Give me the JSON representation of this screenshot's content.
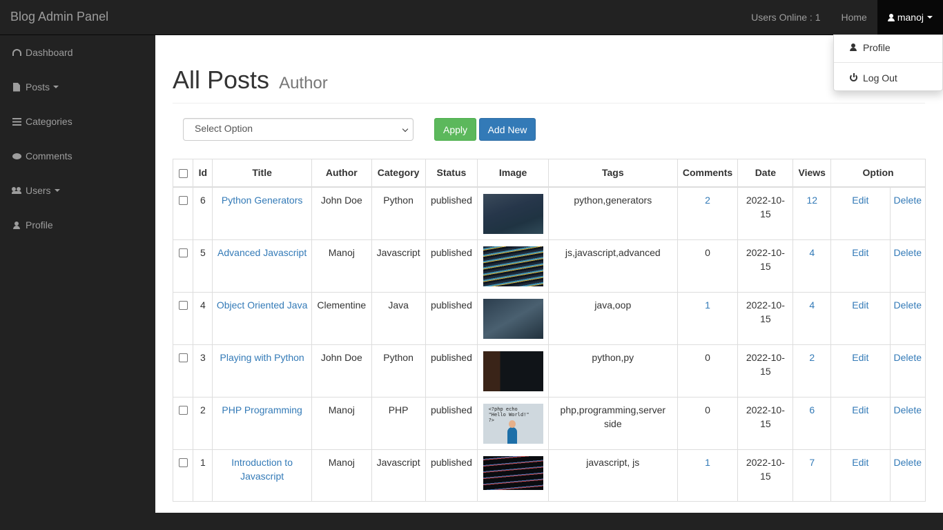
{
  "app": {
    "title": "Blog Admin Panel"
  },
  "topnav": {
    "users_online": "Users Online : 1",
    "home": "Home",
    "username": "manoj"
  },
  "user_menu": {
    "profile": "Profile",
    "logout": "Log Out"
  },
  "sidebar": {
    "items": [
      {
        "label": "Dashboard",
        "icon": "dashboard-icon"
      },
      {
        "label": "Posts",
        "icon": "file-icon"
      },
      {
        "label": "Categories",
        "icon": "list-icon"
      },
      {
        "label": "Comments",
        "icon": "comments-icon"
      },
      {
        "label": "Users",
        "icon": "users-icon"
      },
      {
        "label": "Profile",
        "icon": "user-icon"
      }
    ]
  },
  "page": {
    "title": "All Posts",
    "subtitle": "Author"
  },
  "bulk": {
    "select_value": "Select Option",
    "apply_label": "Apply",
    "add_label": "Add New"
  },
  "table": {
    "headers": [
      "Id",
      "Title",
      "Author",
      "Category",
      "Status",
      "Image",
      "Tags",
      "Comments",
      "Date",
      "Views",
      "Option"
    ],
    "rows": [
      {
        "id": "6",
        "title": "Python Generators",
        "author": "John Doe",
        "category": "Python",
        "status": "published",
        "tags": "python,generators",
        "comments": "2",
        "date": "2022-10-15",
        "views": "12",
        "edit": "Edit",
        "delete": "Delete"
      },
      {
        "id": "5",
        "title": "Advanced Javascript",
        "author": "Manoj",
        "category": "Javascript",
        "status": "published",
        "tags": "js,javascript,advanced",
        "comments": "0",
        "date": "2022-10-15",
        "views": "4",
        "edit": "Edit",
        "delete": "Delete"
      },
      {
        "id": "4",
        "title": "Object Oriented Java",
        "author": "Clementine",
        "category": "Java",
        "status": "published",
        "tags": "java,oop",
        "comments": "1",
        "date": "2022-10-15",
        "views": "4",
        "edit": "Edit",
        "delete": "Delete"
      },
      {
        "id": "3",
        "title": "Playing with Python",
        "author": "John Doe",
        "category": "Python",
        "status": "published",
        "tags": "python,py",
        "comments": "0",
        "date": "2022-10-15",
        "views": "2",
        "edit": "Edit",
        "delete": "Delete"
      },
      {
        "id": "2",
        "title": "PHP Programming",
        "author": "Manoj",
        "category": "PHP",
        "status": "published",
        "tags": "php,programming,server side",
        "comments": "0",
        "date": "2022-10-15",
        "views": "6",
        "edit": "Edit",
        "delete": "Delete"
      },
      {
        "id": "1",
        "title": "Introduction to Javascript",
        "author": "Manoj",
        "category": "Javascript",
        "status": "published",
        "tags": "javascript, js",
        "comments": "1",
        "date": "2022-10-15",
        "views": "7",
        "edit": "Edit",
        "delete": "Delete"
      }
    ],
    "php_image_text": "<?php echo\n\"Hello World!\"\n?>"
  },
  "colors": {
    "navbar": "#222222",
    "link": "#337ab7",
    "apply": "#5cb85c",
    "add_new": "#337ab7"
  }
}
